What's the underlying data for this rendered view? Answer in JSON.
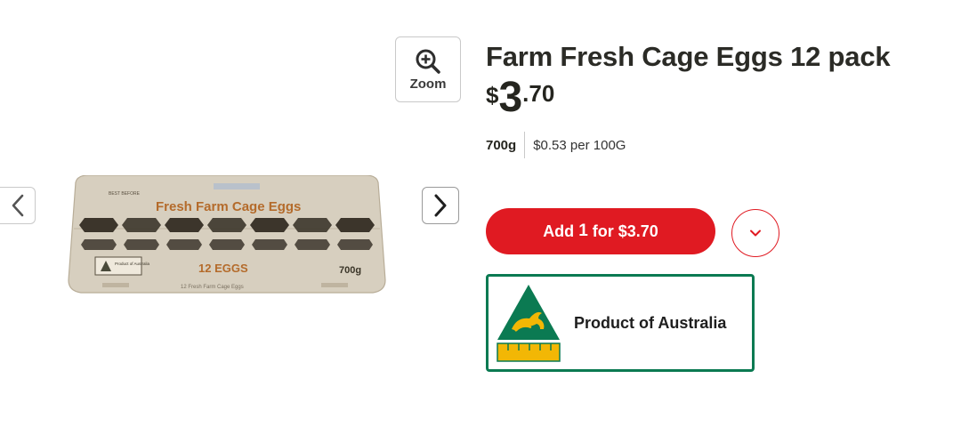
{
  "gallery": {
    "zoom_label": "Zoom",
    "carton": {
      "brand_text": "Fresh Farm Cage Eggs",
      "count_text": "12 EGGS",
      "weight_text": "700g",
      "best_before_text": "BEST BEFORE",
      "footer_text": "12 Fresh Farm Cage Eggs",
      "badge_text": "Product of Australia"
    }
  },
  "product": {
    "title": "Farm Fresh Cage Eggs 12 pack",
    "price": {
      "currency": "$",
      "dollars": "3",
      "cents": ".70"
    },
    "size": "700g",
    "unit_price": "$0.53 per 100G"
  },
  "actions": {
    "add_prefix": "Add",
    "add_qty": "1",
    "add_suffix": "for $3.70"
  },
  "origin": {
    "label": "Product of Australia"
  },
  "colors": {
    "accent": "#e01a22",
    "origin_green": "#0b7a52",
    "logo_gold": "#f2b705"
  },
  "icons": [
    "chevron-left-icon",
    "chevron-right-icon",
    "zoom-in-icon",
    "chevron-down-icon",
    "australian-made-logo-icon"
  ]
}
